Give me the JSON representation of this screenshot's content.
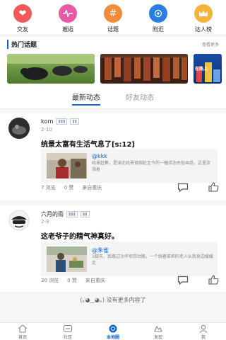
{
  "quick_links": [
    {
      "label": "交友",
      "icon": "heart-icon",
      "color": "#f0595a"
    },
    {
      "label": "邂逅",
      "icon": "heartbeat-icon",
      "color": "#e85aa6"
    },
    {
      "label": "话题",
      "icon": "hashtag-icon",
      "color": "#f28b3a"
    },
    {
      "label": "附近",
      "icon": "location-icon",
      "color": "#2a7de1"
    },
    {
      "label": "达人榜",
      "icon": "crown-icon",
      "color": "#f3b43a"
    }
  ],
  "topics": {
    "title": "热门话题",
    "more": "查看更多",
    "card3_caption": "在路上"
  },
  "feed_tabs": [
    {
      "label": "最新动态"
    },
    {
      "label": "好友动态"
    }
  ],
  "posts": [
    {
      "user": "korn",
      "date": "2-10",
      "text": "统景太富有生活气息了[s:12]",
      "quote_user": "@kkk",
      "quote_text": "统景赶集，是渝北统景镇绵延至今的一幅活态民俗画卷。这里流淌着",
      "views": "7 浏览",
      "likes": "0 赞",
      "source": "来自重庆"
    },
    {
      "user": "六月的雨",
      "date": "2-9",
      "text": "这老爷子的精气神真好。",
      "quote_user": "@朱雀",
      "quote_text": "1脚天，我路过沙坪坝劳动路，一个挑着菜担的老人从我身边缓缓走",
      "views": "30 浏览",
      "likes": "0 赞",
      "source": "来自重庆"
    }
  ],
  "end_message": "(｡◕‿◕｡) 没有更多内容了",
  "tabbar": [
    {
      "label": "首页",
      "icon": "home-icon"
    },
    {
      "label": "社区",
      "icon": "community-icon"
    },
    {
      "label": "本地圈",
      "icon": "local-circle-icon"
    },
    {
      "label": "发现",
      "icon": "discover-icon"
    },
    {
      "label": "我",
      "icon": "profile-icon"
    }
  ],
  "colors": {
    "accent": "#0f64d8"
  }
}
